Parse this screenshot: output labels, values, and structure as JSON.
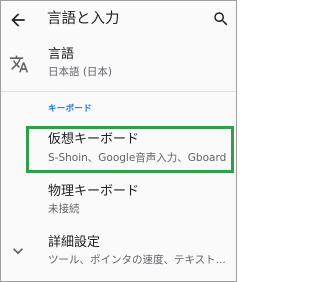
{
  "toolbar": {
    "title": "言語と入力",
    "back_icon": "arrow-back-icon",
    "search_icon": "search-icon"
  },
  "language": {
    "icon": "translate-icon",
    "primary": "言語",
    "secondary": "日本語 (日本)"
  },
  "keyboard_section": {
    "header": "キーボード"
  },
  "virtual_keyboard": {
    "primary": "仮想キーボード",
    "secondary": "S-Shoin、Google音声入力、Gboard",
    "highlight_color": "#2ea04a"
  },
  "physical_keyboard": {
    "primary": "物理キーボード",
    "secondary": "未接続"
  },
  "advanced": {
    "icon": "chevron-down-icon",
    "primary": "詳細設定",
    "secondary": "ツール、ポインタの速度、テキスト..."
  },
  "colors": {
    "accent": "#1a73e8",
    "primary_text": "#202124",
    "secondary_text": "#5f6368",
    "highlight": "#2ea04a"
  }
}
